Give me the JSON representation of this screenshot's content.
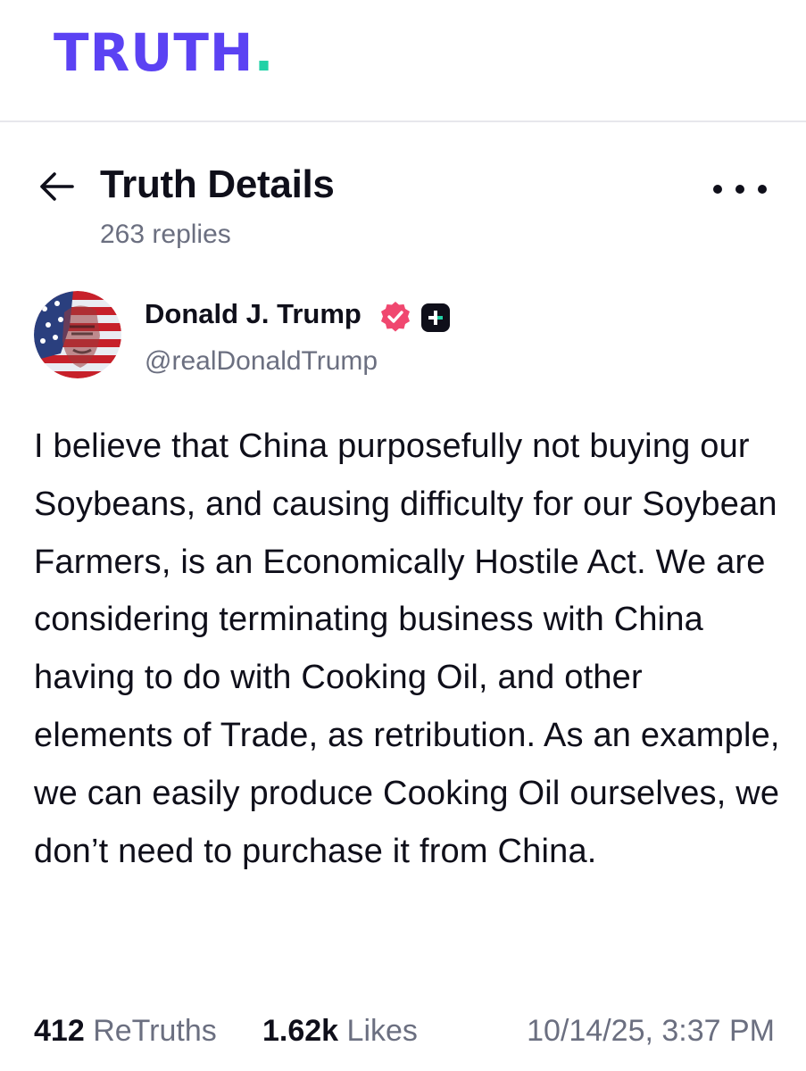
{
  "brand": {
    "logo_text": "TRUTH",
    "logo_dot": ".",
    "primary_color": "#5b42f3",
    "accent_color": "#21d1a6"
  },
  "header": {
    "title": "Truth Details",
    "replies": "263 replies",
    "back_icon": "arrow-left-icon",
    "more_icon": "more-horizontal-icon"
  },
  "author": {
    "display_name": "Donald J. Trump",
    "handle": "@realDonaldTrump",
    "verified_color": "#f0476f",
    "verified_icon": "verified-badge-icon",
    "plus_icon": "plus-badge-icon"
  },
  "post": {
    "text": "I believe that China purposefully not buying our Soybeans, and causing difficulty for our Soybean Farmers, is an Economically Hostile Act. We are considering terminating business with China having to do with Cooking Oil, and other elements of Trade, as retribution. As an example, we can easily produce Cooking Oil ourselves, we don’t need to purchase it from China."
  },
  "stats": {
    "retruths_count": "412",
    "retruths_label": "ReTruths",
    "likes_count": "1.62k",
    "likes_label": "Likes",
    "timestamp": "10/14/25, 3:37 PM"
  }
}
